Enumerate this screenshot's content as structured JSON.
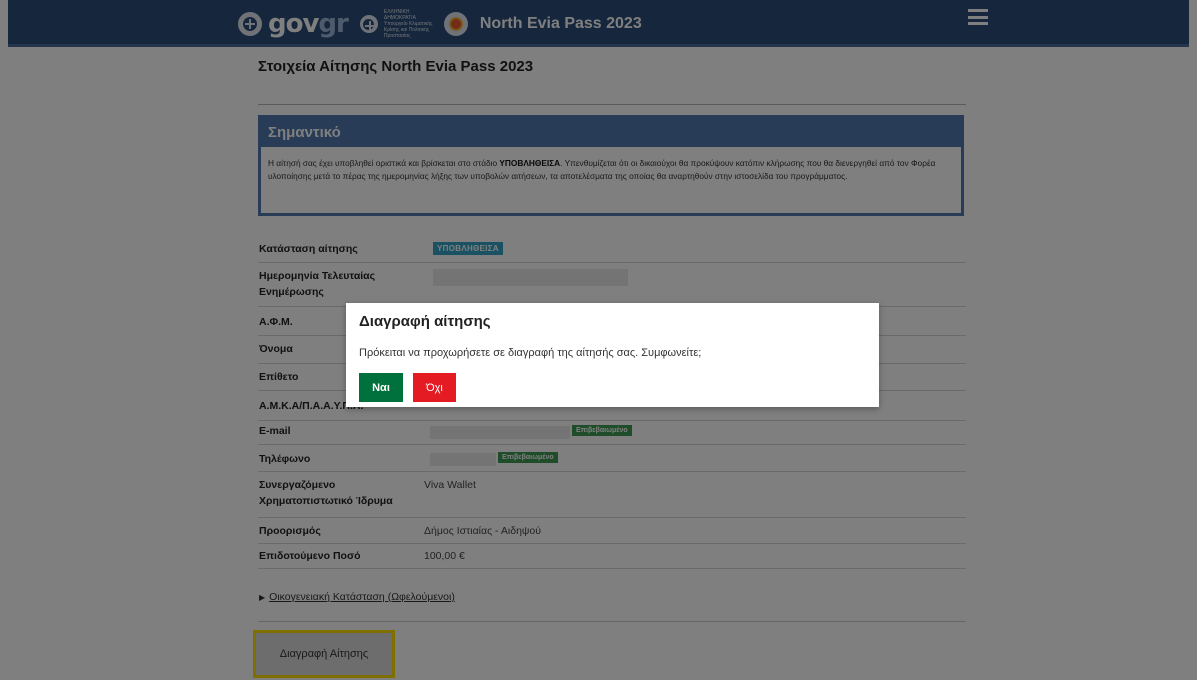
{
  "header": {
    "brand_gov": "gov",
    "brand_gr": "gr",
    "ministry_text": "ΕΛΛΗΝΙΚΗ ΔΗΜΟΚΡΑΤΙΑ Υπουργείο Κλιματικής Κρίσης και Πολιτικής Προστασίας",
    "app_title": "North Evia Pass 2023"
  },
  "page": {
    "title": "Στοιχεία Αίτησης North Evia Pass 2023"
  },
  "notice": {
    "heading": "Σημαντικό",
    "text_before": "Η αίτησή σας έχει υποβληθεί οριστικά και βρίσκεται στο στάδιο ",
    "status_word": "ΥΠΟΒΛΗΘΕΙΣΑ",
    "text_after": ". Υπενθυμίζεται ότι οι δικαιούχοι θα προκύψουν κατόπιν κλήρωσης που θα διενεργηθεί από τον Φορέα υλοποίησης μετά το πέρας της ημερομηνίας λήξης των υποβολών αιτήσεων, τα αποτελέσματα της οποίας θα αναρτηθούν στην ιστοσελίδα του προγράμματος."
  },
  "fields": {
    "status_label": "Κατάσταση αίτησης",
    "status_value": "ΥΠΟΒΛΗΘΕΙΣΑ",
    "last_update_label": "Ημερομηνία Τελευταίας Ενημέρωσης",
    "afm_label": "Α.Φ.Μ.",
    "name_label": "Όνομα",
    "surname_label": "Επίθετο",
    "amka_label": "Α.Μ.Κ.Α/Π.Α.Α.Υ.Π.Α.",
    "email_label": "E-mail",
    "email_badge": "Επιβεβαιωμένο",
    "phone_label": "Τηλέφωνο",
    "phone_badge": "Επιβεβαιωμένο",
    "bank_label": "Συνεργαζόμενο Χρηματοπιστωτικό Ίδρυμα",
    "bank_value": "Viva Wallet",
    "destination_label": "Προορισμός",
    "destination_value": "Δήμος Ιστιαίας - Αιδηψού",
    "amount_label": "Επιδοτούμενο Ποσό",
    "amount_value": "100,00 €"
  },
  "details": {
    "link_text": "Οικογενειακή Κατάσταση (Ωφελούμενοι)"
  },
  "actions": {
    "delete_label": "Διαγραφή Αίτησης"
  },
  "modal": {
    "title": "Διαγραφή αίτησης",
    "message": "Πρόκειται να προχωρήσετε σε διαγραφή της αίτησής σας. Συμφωνείτε;",
    "yes_label": "Ναι",
    "no_label": "Όχι"
  },
  "colors": {
    "header_bg": "#2c4d7a",
    "notice_blue": "#5079b0",
    "status_tag": "#35a5c7",
    "verified_tag": "#3f9a53",
    "yes_button": "#00703c",
    "no_button": "#e51b24",
    "focus_yellow": "#ffdd00"
  }
}
